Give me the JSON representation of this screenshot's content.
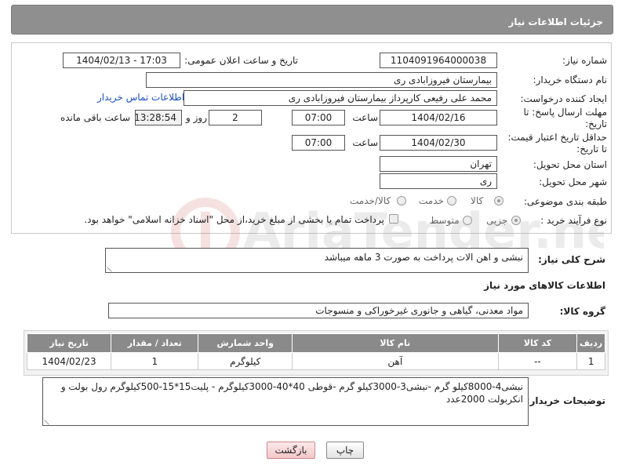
{
  "header": {
    "title": "جزئیات اطلاعات نیاز"
  },
  "fields": {
    "need_number_label": "شماره نیاز:",
    "need_number": "1104091964000038",
    "announce_label": "تاریخ و ساعت اعلان عمومی:",
    "announce_value": "1404/02/13 - 17:03",
    "buyer_label": "نام دستگاه خریدار:",
    "buyer_value": "بیمارستان فیروزابادی ری",
    "creator_label": "ایجاد کننده درخواست:",
    "creator_value": "محمد علی رفیعی کارپرداز بیمارستان فیروزابادی ری",
    "contact_link": "اطلاعات تماس خریدار",
    "deadline_label": "مهلت ارسال پاسخ: تا تاریخ:",
    "deadline_date": "1404/02/16",
    "time_label": "ساعت",
    "deadline_time": "07:00",
    "days_value": "2",
    "days_label": "روز و",
    "remaining_time": "13:28:54",
    "remaining_label": "ساعت باقی مانده",
    "validity_label": "حداقل تاریخ اعتبار قیمت: تا تاریخ:",
    "validity_date": "1404/02/30",
    "validity_time_label": "ساعت",
    "validity_time": "07:00",
    "province_label": "استان محل تحویل:",
    "province_value": "تهران",
    "city_label": "شهر محل تحویل:",
    "city_value": "ری",
    "category_label": "طبقه بندی موضوعی:",
    "category_options": [
      "کالا",
      "خدمت",
      "کالا/خدمت"
    ],
    "process_label": "نوع فرآیند خرید :",
    "process_options": [
      "جزیی",
      "متوسط"
    ],
    "payment_note": "پرداخت تمام یا بخشی از مبلغ خرید،از محل \"اسناد خزانه اسلامی\" خواهد بود.",
    "summary_label": "شرح کلی نیاز:",
    "summary_value": "نبشی و اهن الات پرداخت به صورت 3 ماهه میباشد",
    "goods_info_title": "اطلاعات کالاهای مورد نیاز",
    "goods_group_label": "گروه کالا:",
    "goods_group_value": "مواد معدنی، گیاهی و جانوری غیرخوراکی و منسوجات",
    "buyer_notes_label": "توضیحات خریدار:",
    "buyer_notes_value": "نبشی4-8000کیلو گرم -نبشی3-3000کیلو گرم -قوطی 40*40-3000کیلوگرم - پلیت15*15-500کیلوگرم رول بولت و انکربولت 2000عدد"
  },
  "table": {
    "headers": [
      "ردیف",
      "کد کالا",
      "نام کالا",
      "واحد شمارش",
      "تعداد / مقدار",
      "تاریخ نیاز"
    ],
    "rows": [
      [
        "1",
        "--",
        "آهن",
        "کیلوگرم",
        "1",
        "1404/02/23"
      ]
    ]
  },
  "buttons": {
    "print": "چاپ",
    "back": "بازگشت"
  },
  "watermark": {
    "text": "AriaTender.net"
  },
  "colors": {
    "header_bg": "#8f8f8f",
    "link": "#1a4fc4",
    "back_button": "#f2c7c9"
  }
}
